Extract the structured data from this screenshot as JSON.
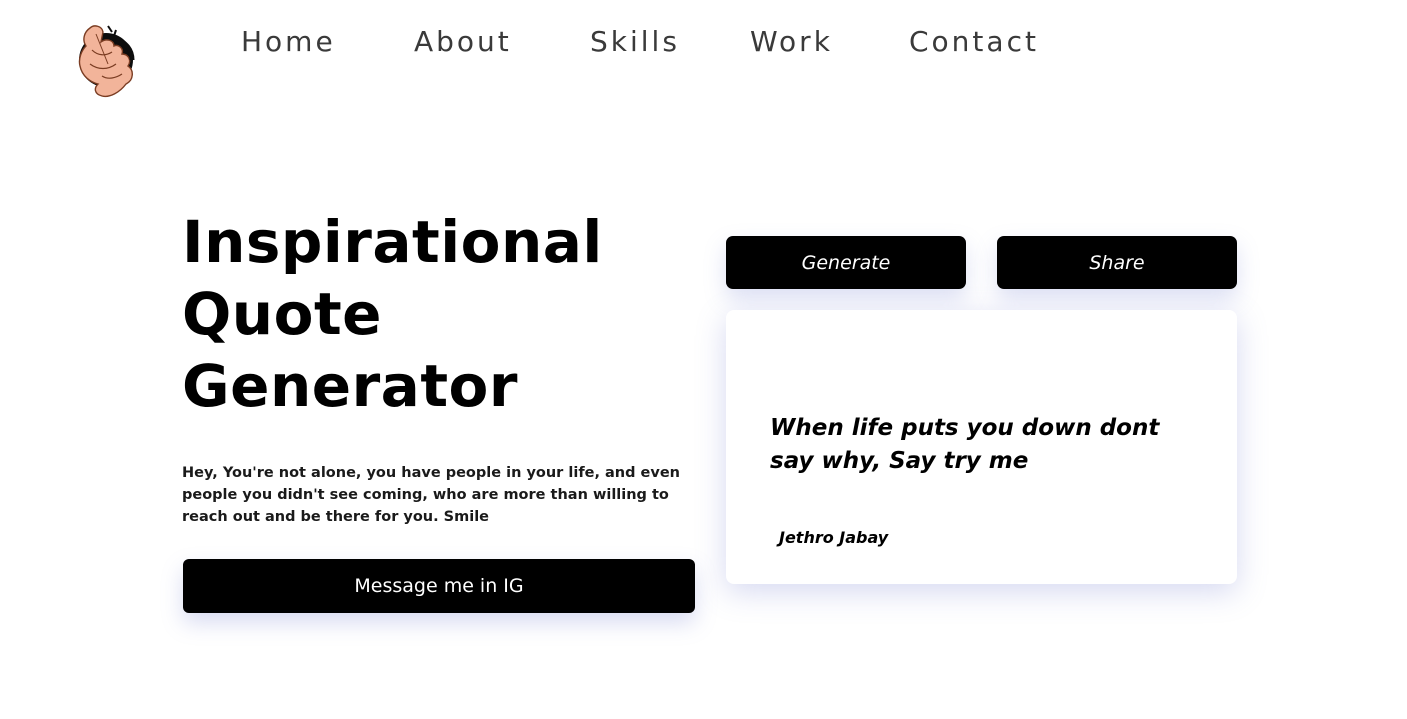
{
  "header": {
    "logo_icon": "hand-holding-circle-logo",
    "nav": {
      "home": "Home",
      "about": "About",
      "skills": "Skills",
      "work": "Work",
      "contact": "Contact"
    }
  },
  "hero": {
    "title_lines": [
      "Inspirational",
      "Quote",
      "Generator"
    ],
    "description": "Hey, You're not alone, you have people in your life, and even people you didn't see coming, who are more than willing to reach out and be there for you. Smile",
    "ig_button_label": "Message me in IG"
  },
  "quote_panel": {
    "generate_label": "Generate",
    "share_label": "Share",
    "quote": "When life puts you down dont say why, Say try me",
    "author": "Jethro Jabay"
  },
  "colors": {
    "button_bg": "#000000",
    "button_text": "#ffffff",
    "nav_text": "#3a3a3a",
    "shadow_tint": "#7882d2"
  }
}
